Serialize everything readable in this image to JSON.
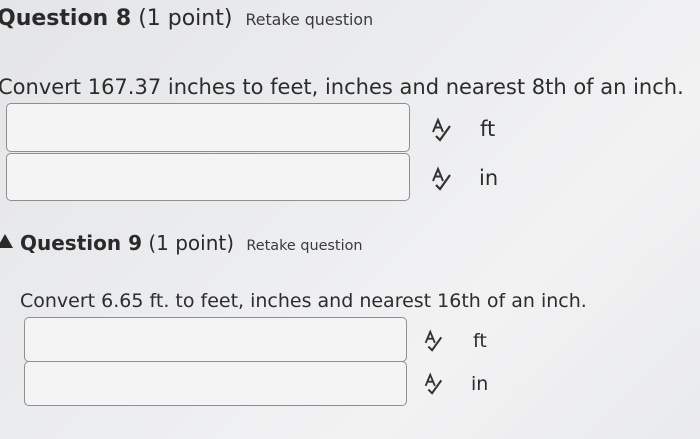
{
  "question8": {
    "title": "Question 8",
    "points": "(1 point)",
    "retake": "Retake question",
    "prompt": "Convert 167.37 inches to feet, inches and nearest 8th of an inch.",
    "fields": [
      {
        "value": "",
        "unit": "ft",
        "icon": "spellcheck-icon"
      },
      {
        "value": "",
        "unit": "in",
        "icon": "spellcheck-icon"
      }
    ]
  },
  "question9": {
    "title": "Question 9",
    "points": "(1 point)",
    "retake": "Retake question",
    "prompt": "Convert 6.65 ft. to feet, inches and nearest 16th of an inch.",
    "fields": [
      {
        "value": "",
        "unit": "ft",
        "icon": "spellcheck-icon"
      },
      {
        "value": "",
        "unit": "in",
        "icon": "spellcheck-icon"
      }
    ],
    "status_icon": "warning-icon"
  }
}
